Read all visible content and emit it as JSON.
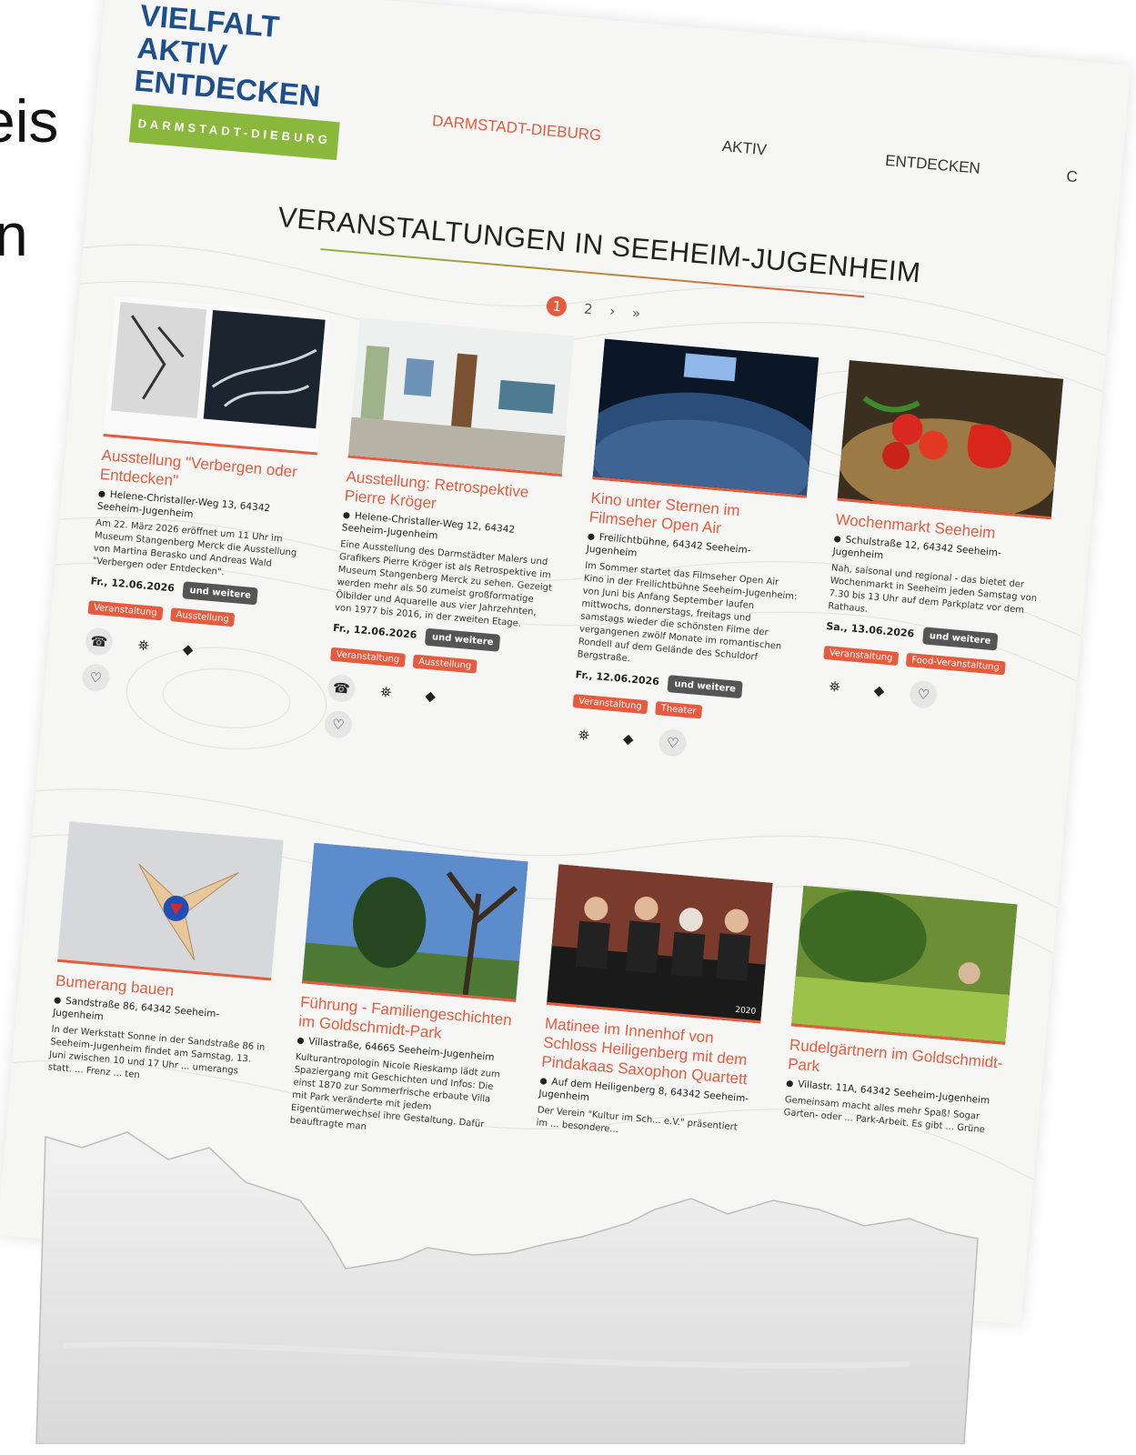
{
  "cut_text": {
    "line1": "eis",
    "line2": "n"
  },
  "logo": {
    "line1": "VIELFALT",
    "line2": "AKTIV",
    "line3": "ENTDECKEN",
    "band": "DARMSTADT-DIEBURG"
  },
  "nav": {
    "item1": "DARMSTADT-DIEBURG",
    "item2": "AKTIV",
    "item3": "ENTDECKEN",
    "item4": "C"
  },
  "page_title": "VERANSTALTUNGEN IN SEEHEIM-JUGENHEIM",
  "pager": {
    "p1": "1",
    "p2": "2",
    "next": "›",
    "last": "»"
  },
  "colors": {
    "accent": "#e65a3d",
    "brand_blue": "#1d4f8c",
    "brand_green": "#8ab83c"
  },
  "icons": {
    "phone": "phone-icon",
    "map": "map-icon",
    "directions": "directions-icon",
    "favorite": "heart-icon"
  },
  "cards": [
    {
      "title": "Ausstellung \"Verbergen oder Entdecken\"",
      "address": "Helene-Christaller-Weg 13, 64342 Seeheim-Jugenheim",
      "desc": "Am 22. März 2026 eröffnet um 11 Uhr im Museum Stangenberg Merck die Ausstellung von Martina Berasko und Andreas Wald \"Verbergen oder Entdecken\".",
      "date": "Fr., 12.06.2026",
      "more": "und weitere",
      "tag1": "Veranstaltung",
      "tag2": "Ausstellung"
    },
    {
      "title": "Ausstellung: Retrospektive Pierre Kröger",
      "address": "Helene-Christaller-Weg 12, 64342 Seeheim-Jugenheim",
      "desc": "Eine Ausstellung des Darmstädter Malers und Grafikers Pierre Kröger ist als Retrospektive im Museum Stangenberg Merck zu sehen. Gezeigt werden mehr als 50 zumeist großformatige Ölbilder und Aquarelle aus vier Jahrzehnten, von 1977 bis 2016, in der zweiten Etage.",
      "date": "Fr., 12.06.2026",
      "more": "und weitere",
      "tag1": "Veranstaltung",
      "tag2": "Ausstellung"
    },
    {
      "title": "Kino unter Sternen im Filmseher Open Air",
      "address": "Freilichtbühne, 64342 Seeheim-Jugenheim",
      "desc": "Im Sommer startet das Filmseher Open Air Kino in der Freilichtbühne Seeheim-Jugenheim: von Juni bis Anfang September laufen mittwochs, donnerstags, freitags und samstags wieder die schönsten Filme der vergangenen zwölf Monate im romantischen Rondell auf dem Gelände des Schuldorf Bergstraße.",
      "date": "Fr., 12.06.2026",
      "more": "und weitere",
      "tag1": "Veranstaltung",
      "tag2": "Theater"
    },
    {
      "title": "Wochenmarkt Seeheim",
      "address": "Schulstraße 12, 64342 Seeheim-Jugenheim",
      "desc": "Nah, saisonal und regional - das bietet der Wochenmarkt in Seeheim jeden Samstag von 7.30 bis 13 Uhr auf dem Parkplatz vor dem Rathaus.",
      "date": "Sa., 13.06.2026",
      "more": "und weitere",
      "tag1": "Veranstaltung",
      "tag2": "Food-Veranstaltung"
    },
    {
      "title": "Bumerang bauen",
      "address": "Sandstraße 86, 64342 Seeheim-Jugenheim",
      "desc": "In der Werkstatt Sonne in der Sandstraße 86 in Seeheim-Jugenheim findet am Samstag, 13. Juni zwischen 10 und 17 Uhr ... umerangs statt. ... Frenz ... ten"
    },
    {
      "title": "Führung - Familiengeschichten im Goldschmidt-Park",
      "address": "Villastraße, 64665 Seeheim-Jugenheim",
      "desc": "Kulturantropologin Nicole Rieskamp lädt zum Spaziergang mit Geschichten und Infos: Die einst 1870 zur Sommerfrische erbaute Villa mit Park veränderte mit jedem Eigentümerwechsel ihre Gestaltung. Dafür beauftragte man"
    },
    {
      "title": "Matinee im Innenhof von Schloss Heiligenberg mit dem Pindakaas Saxophon Quartett",
      "address": "Auf dem Heiligenberg 8, 64342 Seeheim-Jugenheim",
      "desc": "Der Verein \"Kultur im Sch... e.V.\" präsentiert im ... besondere...",
      "year": "2020"
    },
    {
      "title": "Rudelgärtnern im Goldschmidt-Park",
      "address": "Villastr. 11A, 64342 Seeheim-Jugenheim",
      "desc": "Gemeinsam macht alles mehr Spaß! Sogar Garten- oder ... Park-Arbeit. Es gibt ... Grüne"
    }
  ]
}
